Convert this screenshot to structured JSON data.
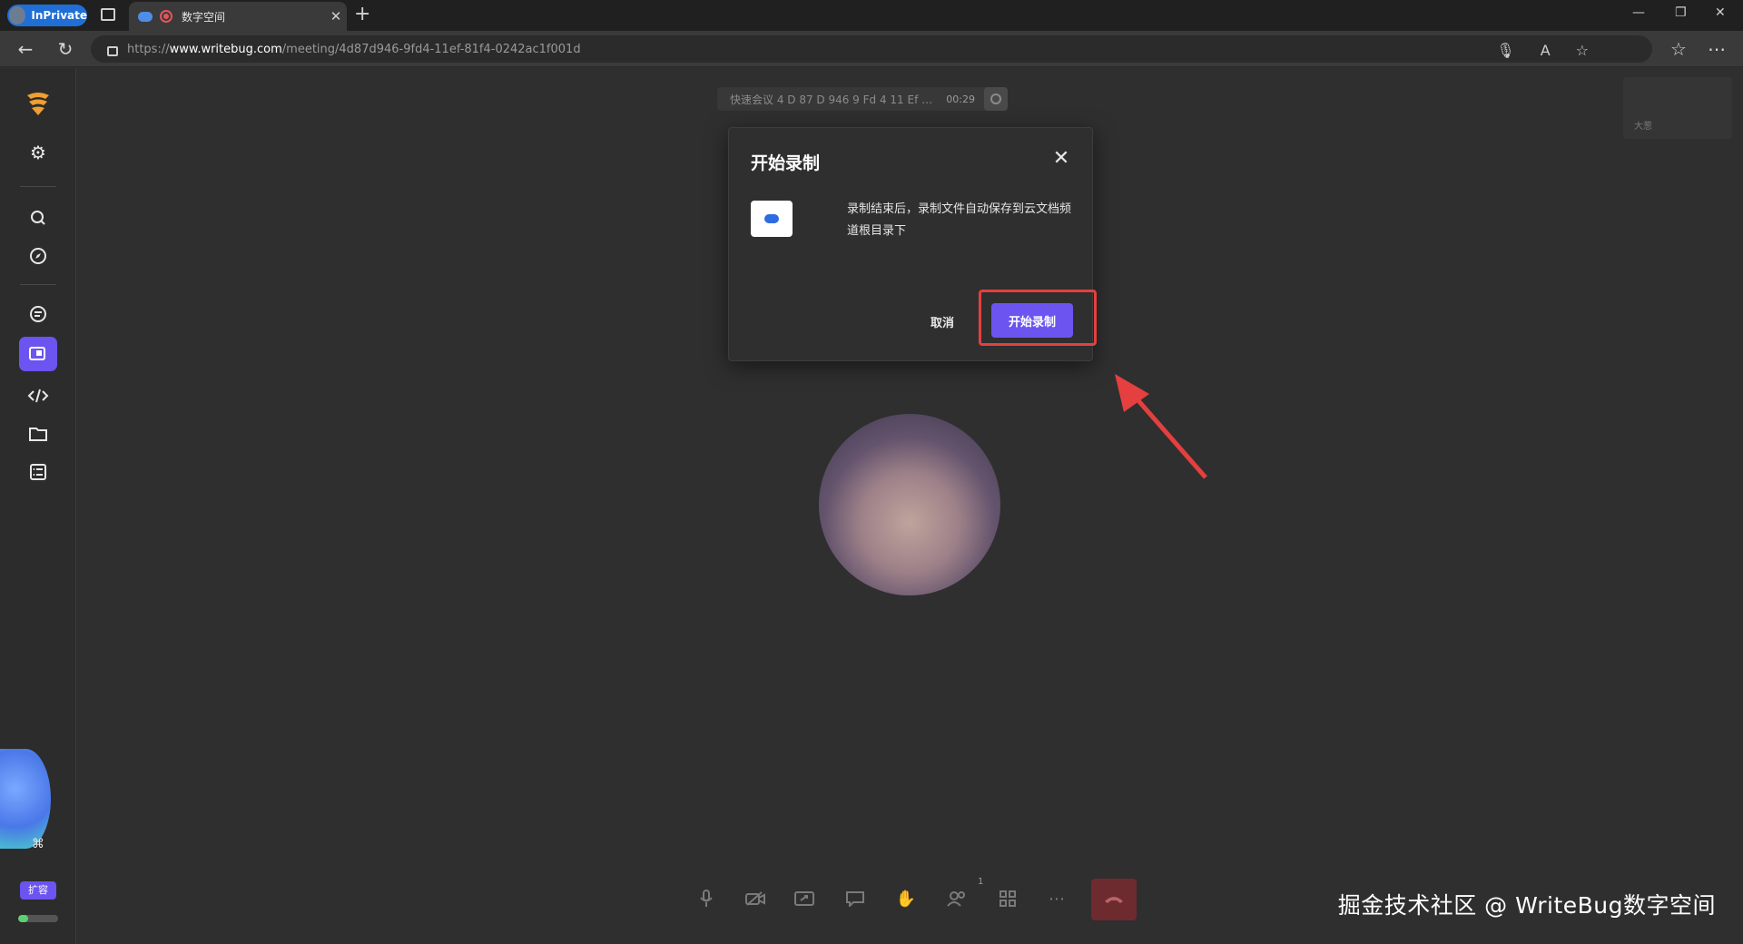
{
  "browser": {
    "inprivate_label": "InPrivate",
    "tab_title": "数字空间",
    "url_prefix": "https://",
    "url_host": "www.writebug.com",
    "url_path": "/meeting/4d87d946-9fd4-11ef-81f4-0242ac1f001d"
  },
  "meeting": {
    "name": "快速会议 4 D 87 D 946 9 Fd 4 11 Ef 81 F 4 0...",
    "timer": "00:29",
    "self_view_tag": "大葱"
  },
  "dialog": {
    "title": "开始录制",
    "description": "录制结束后，录制文件自动保存到云文档频道根目录下",
    "cancel_label": "取消",
    "start_label": "开始录制"
  },
  "sidebar": {
    "expand_label": "扩容",
    "storage_used_fraction": 0.25
  },
  "toolbar": {
    "participants_count": "1"
  },
  "watermark": "掘金技术社区 @ WriteBug数字空间",
  "colors": {
    "accent": "#6b54f0",
    "highlight": "#e53f3f",
    "hangup": "#6d2a2f"
  }
}
